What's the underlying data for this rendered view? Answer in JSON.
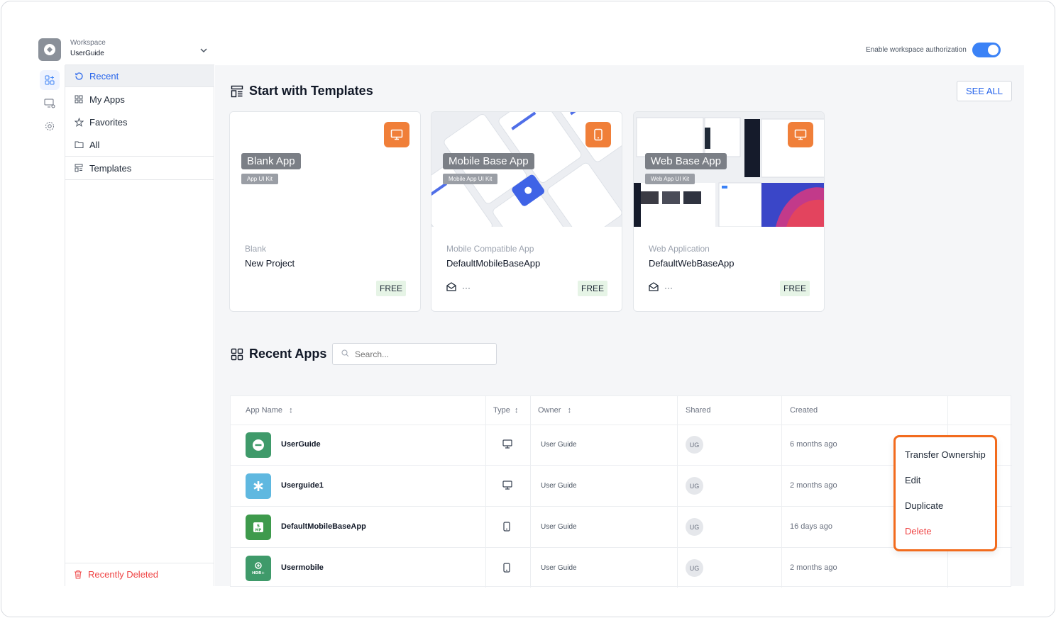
{
  "workspace": {
    "label": "Workspace",
    "name": "UserGuide"
  },
  "sidebar": {
    "items": [
      {
        "label": "Recent",
        "icon": "history-icon",
        "active": true
      },
      {
        "label": "My Apps",
        "icon": "grid-icon"
      },
      {
        "label": "Favorites",
        "icon": "star-icon"
      },
      {
        "label": "All",
        "icon": "folder-icon"
      },
      {
        "label": "Templates",
        "icon": "template-icon"
      }
    ],
    "recently_deleted": "Recently Deleted"
  },
  "topbar": {
    "auth_label": "Enable workspace authorization",
    "auth_enabled": true
  },
  "templates": {
    "title": "Start with Templates",
    "see_all": "SEE ALL",
    "cards": [
      {
        "tag": "Blank App",
        "subtag": "App UI Kit",
        "category": "Blank",
        "name": "New Project",
        "price": "FREE",
        "icon": "monitor-icon"
      },
      {
        "tag": "Mobile Base App",
        "subtag": "Mobile App UI Kit",
        "category": "Mobile Compatible App",
        "name": "DefaultMobileBaseApp",
        "price": "FREE",
        "icon": "phone-icon",
        "more": "···"
      },
      {
        "tag": "Web Base App",
        "subtag": "Web App UI Kit",
        "category": "Web Application",
        "name": "DefaultWebBaseApp",
        "price": "FREE",
        "icon": "monitor-icon",
        "more": "···"
      }
    ]
  },
  "recent": {
    "title": "Recent Apps",
    "search_placeholder": "Search...",
    "columns": [
      "App Name",
      "Type",
      "Owner",
      "Shared",
      "Created"
    ],
    "rows": [
      {
        "name": "UserGuide",
        "type": "desktop",
        "owner": "User Guide",
        "shared": "UG",
        "created": "6 months ago",
        "color": "#3f9a6a"
      },
      {
        "name": "Userguide1",
        "type": "desktop",
        "owner": "User Guide",
        "shared": "UG",
        "created": "2 months ago",
        "color": "#5fb8e0"
      },
      {
        "name": "DefaultMobileBaseApp",
        "type": "mobile",
        "owner": "User Guide",
        "shared": "UG",
        "created": "16 days ago",
        "color": "#3e9a4c"
      },
      {
        "name": "Usermobile",
        "type": "mobile",
        "owner": "User Guide",
        "shared": "UG",
        "created": "2 months ago",
        "color": "#3f9a6a"
      }
    ]
  },
  "context_menu": {
    "items": [
      {
        "label": "Transfer Ownership"
      },
      {
        "label": "Edit"
      },
      {
        "label": "Duplicate"
      },
      {
        "label": "Delete",
        "danger": true
      }
    ]
  },
  "colors": {
    "accent": "#2563eb",
    "badge": "#f07f39",
    "menu_border": "#f26b1d",
    "danger": "#ef4444"
  }
}
